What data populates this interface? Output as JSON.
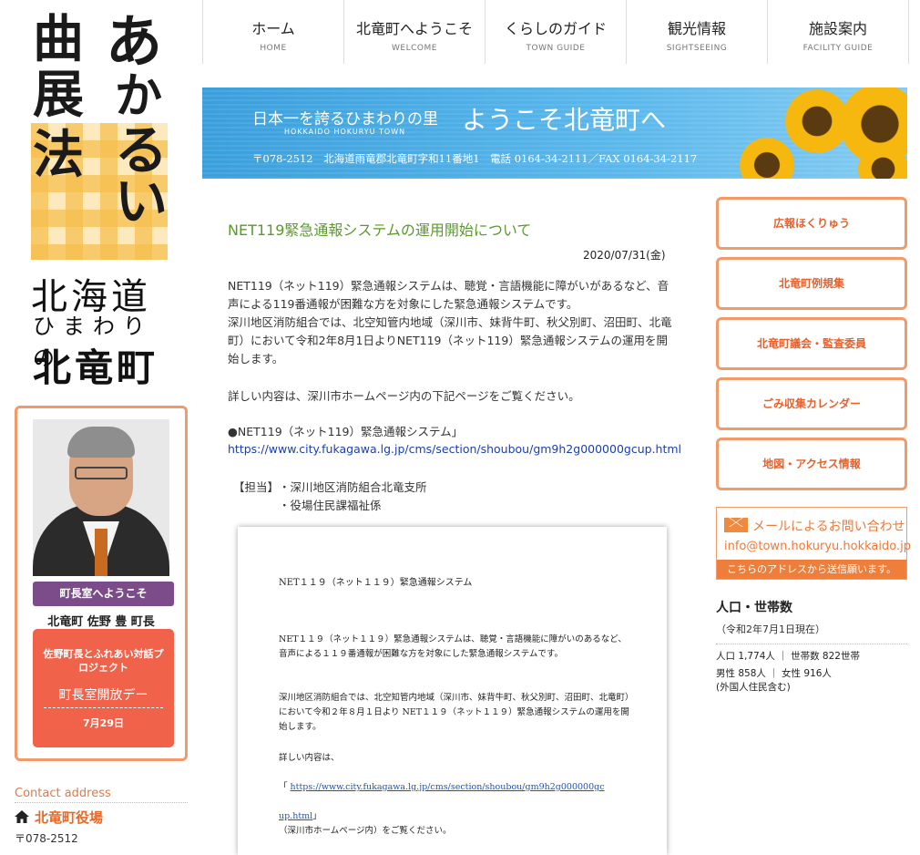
{
  "logo": {
    "lines_big": [
      "曲",
      "展",
      "法",
      "あ",
      "か",
      "る",
      "い"
    ],
    "hokkaido": "北海道",
    "himawari": "ひまわりの",
    "town": "北竜町"
  },
  "nav": [
    {
      "jp": "ホーム",
      "en": "HOME"
    },
    {
      "jp": "北竜町へようこそ",
      "en": "WELCOME"
    },
    {
      "jp": "くらしのガイド",
      "en": "TOWN GUIDE"
    },
    {
      "jp": "観光情報",
      "en": "SIGHTSEEING"
    },
    {
      "jp": "施設案内",
      "en": "FACILITY GUIDE"
    }
  ],
  "banner": {
    "tagline": "日本一を誇るひまわりの里",
    "tagline_en": "HOKKAIDO HOKURYU TOWN",
    "welcome": "ようこそ北竜町へ",
    "address": "〒078-2512　北海道雨竜郡北竜町字和11番地1　電話 0164-34-2111／FAX 0164-34-2117"
  },
  "mayor": {
    "welcome": "町長室へようこそ",
    "name": "北竜町 佐野 豊 町長",
    "event_title": "佐野町長とふれあい対話プロジェクト",
    "event_name": "町長室開放デー",
    "event_date": "7月29日"
  },
  "contact": {
    "label": "Contact address",
    "office": "北竜町役場",
    "zip": "〒078-2512"
  },
  "article": {
    "title": "NET119緊急通報システムの運用開始について",
    "date": "2020/07/31(金)",
    "p1": "NET119（ネット119）緊急通報システムは、聴覚・言語機能に障がいがあるなど、音声による119番通報が困難な方を対象にした緊急通報システムです。\n深川地区消防組合では、北空知管内地域（深川市、妹背牛町、秋父別町、沼田町、北竜町）において令和2年8月1日よりNET119（ネット119）緊急通報システムの運用を開始します。",
    "p2": "詳しい内容は、深川市ホームページ内の下記ページをご覧ください。",
    "p3": "●NET119（ネット119）緊急通報システム」",
    "link": "https://www.city.fukagawa.lg.jp/cms/section/shoubou/gm9h2g000000gcup.html",
    "tanto_label": "【担当】",
    "tanto": [
      "・深川地区消防組合北竜支所",
      "・役場住民課福祉係"
    ]
  },
  "doc": {
    "title": "NET１１９（ネット１１９）緊急通報システム",
    "p1": "NET１１９（ネット１１９）緊急通報システムは、聴覚・言語機能に障がいのあるなど、音声による１１９番通報が困難な方を対象にした緊急通報システムです。",
    "p2": "深川地区消防組合では、北空知管内地域（深川市、妹背牛町、秋父別町、沼田町、北竜町）において令和２年８月１日より NET１１９（ネット１１９）緊急通報システムの運用を開始します。",
    "p3": "詳しい内容は、",
    "link_open": "「",
    "link_a": "https://www.city.fukagawa.lg.jp/cms/section/shoubou/gm9h2g000000gc",
    "link_b": "up.html",
    "link_close": "」",
    "p4": "（深川市ホームページ内）をご覧ください。"
  },
  "sidebar": {
    "buttons": [
      "広報ほくりゅう",
      "北竜町例規集",
      "北竜町議会・監査委員",
      "ごみ収集カレンダー",
      "地図・アクセス情報"
    ],
    "mail_title": "メールによるお問い合わせ",
    "mail_address": "info@town.hokuryu.hokkaido.jp",
    "mail_note": "こちらのアドレスから送信願います。"
  },
  "population": {
    "heading": "人口・世帯数",
    "date": "（令和2年7月1日現在）",
    "line1": "人口 1,774人 ｜ 世帯数 822世帯",
    "line2": "男性 858人 ｜ 女性 916人",
    "line3": "(外国人住民含む)"
  },
  "colors": {
    "accent_orange": "#f29a6a",
    "title_green": "#5a9a2a",
    "mayor_purple": "#7b4b8a",
    "event_red": "#f0624a"
  }
}
